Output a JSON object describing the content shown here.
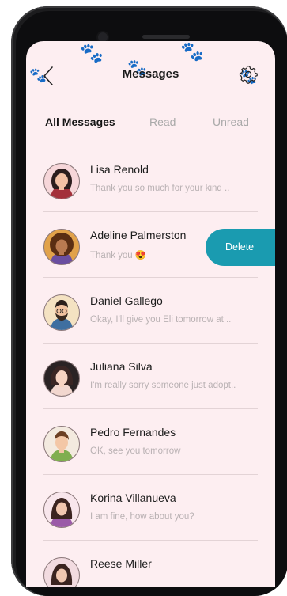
{
  "header": {
    "title": "Messages",
    "back_icon": "chevron-left-icon",
    "settings_icon": "gear-icon"
  },
  "tabs": [
    {
      "label": "All Messages",
      "active": true
    },
    {
      "label": "Read",
      "active": false
    },
    {
      "label": "Unread",
      "active": false
    }
  ],
  "conversations": [
    {
      "name": "Lisa Renold",
      "preview": "Thank you so much for your kind ..",
      "avatar": "woman-red-dress"
    },
    {
      "name": "Adeline Palmerston",
      "preview": "Thank you 😍",
      "avatar": "woman-curly-hair",
      "swipe_action": "Delete"
    },
    {
      "name": "Daniel Gallego",
      "preview": "Okay, I'll give you Eli tomorrow at ..",
      "avatar": "man-beard-glasses"
    },
    {
      "name": "Juliana Silva",
      "preview": "I'm really sorry someone just adopt..",
      "avatar": "woman-dark-hair"
    },
    {
      "name": "Pedro Fernandes",
      "preview": "OK, see you tomorrow",
      "avatar": "man-green-shirt"
    },
    {
      "name": "Korina Villanueva",
      "preview": "I am fine, how about you?",
      "avatar": "woman-purple-top"
    },
    {
      "name": "Reese Miller",
      "preview": "",
      "avatar": "woman-partial"
    }
  ],
  "colors": {
    "background": "#fdeef1",
    "accent": "#1a9bb0",
    "muted_text": "#b9b1b3"
  }
}
